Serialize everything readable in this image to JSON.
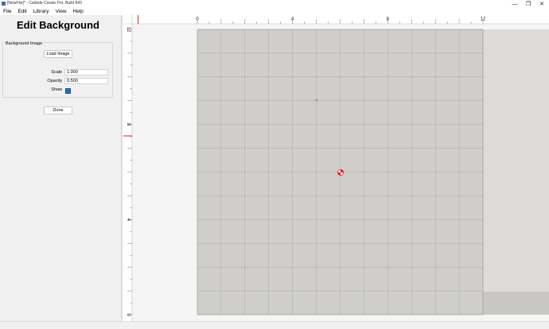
{
  "window": {
    "title": "[NewFile]* - Carbide Create Pro, Build 843",
    "minimize": "—",
    "maximize": "❐",
    "close": "✕"
  },
  "menu": [
    "File",
    "Edit",
    "Library",
    "View",
    "Help"
  ],
  "panel": {
    "title": "Edit Background",
    "group_label": "Background Image",
    "load_button": "Load Image",
    "scale_label": "Scale",
    "scale_value": "1.000",
    "opacity_label": "Opacity",
    "opacity_value": "0.500",
    "show_label": "Show",
    "show_checked": true,
    "done_button": "Done"
  },
  "canvas": {
    "x_ticks": [
      "0",
      "4",
      "8",
      "12"
    ],
    "y_ticks": [
      "12",
      "8",
      "4",
      "0"
    ],
    "colors": {
      "stock": "#cfcecb",
      "grid": "#a9a9a6",
      "ruler_marker": "#e02020",
      "origin_marker": "#e02020"
    }
  }
}
